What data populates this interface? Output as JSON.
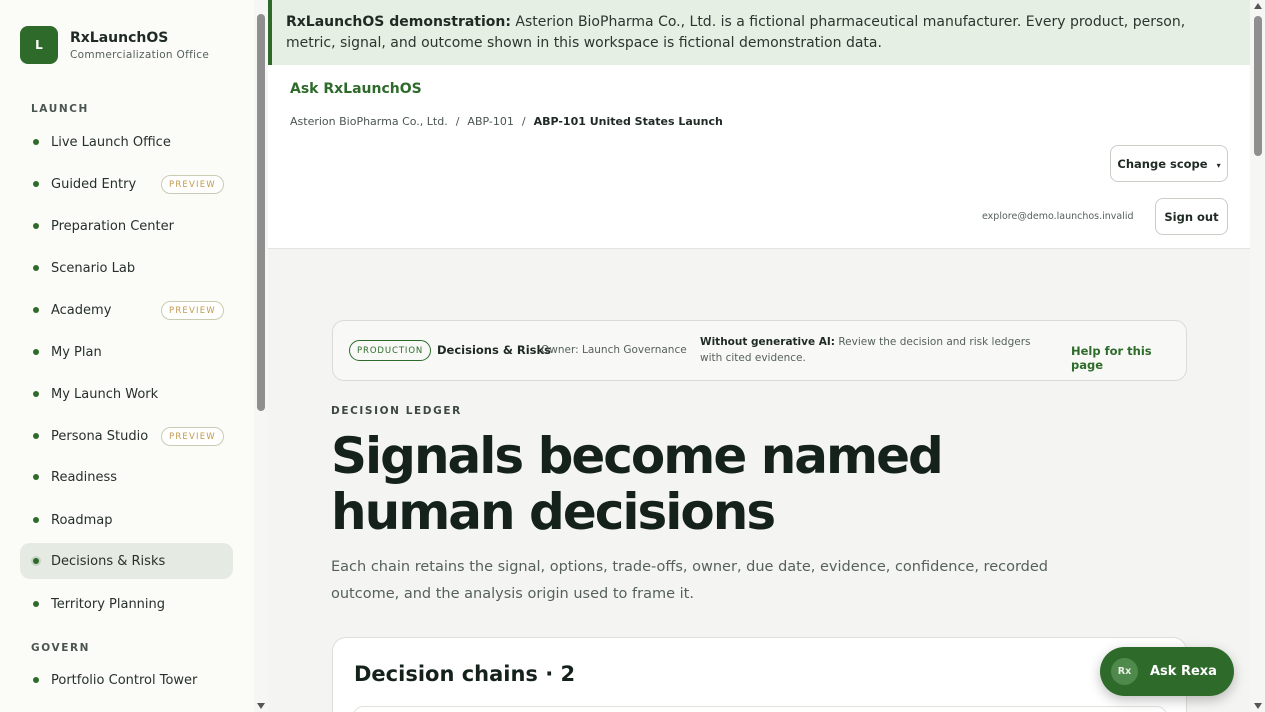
{
  "brand": {
    "logo_letter": "L",
    "name": "RxLaunchOS",
    "subtitle": "Commercialization Office"
  },
  "sidebar": {
    "sections": [
      {
        "label": "LAUNCH"
      },
      {
        "label": "GOVERN"
      }
    ],
    "items": [
      {
        "label": "Live Launch Office"
      },
      {
        "label": "Guided Entry",
        "badge": "PREVIEW"
      },
      {
        "label": "Preparation Center"
      },
      {
        "label": "Scenario Lab"
      },
      {
        "label": "Academy",
        "badge": "PREVIEW"
      },
      {
        "label": "My Plan"
      },
      {
        "label": "My Launch Work"
      },
      {
        "label": "Persona Studio",
        "badge": "PREVIEW"
      },
      {
        "label": "Readiness"
      },
      {
        "label": "Roadmap"
      },
      {
        "label": "Decisions & Risks",
        "active": true
      },
      {
        "label": "Territory Planning"
      },
      {
        "label": "Portfolio Control Tower"
      }
    ]
  },
  "banner": {
    "bold": "RxLaunchOS demonstration:",
    "text": " Asterion BioPharma Co., Ltd. is a fictional pharmaceutical manufacturer. Every product, person, metric, signal, and outcome shown in this workspace is fictional demonstration data."
  },
  "header": {
    "ask_link": "Ask RxLaunchOS",
    "breadcrumb": [
      "Asterion BioPharma Co., Ltd.",
      "ABP-101",
      "ABP-101 United States Launch"
    ],
    "breadcrumb_sep": "/",
    "change_scope": "Change scope",
    "chevron": "▾",
    "email": "explore@demo.launchos.invalid",
    "sign_out": "Sign out"
  },
  "page_strip": {
    "badge": "PRODUCTION",
    "title": "Decisions & Risks",
    "owner": "Owner: Launch Governance",
    "no_ai_label": "Without generative AI:",
    "no_ai_text": " Review the decision and risk ledgers with cited evidence.",
    "help": "Help for this page"
  },
  "hero": {
    "eyebrow": "DECISION LEDGER",
    "title": "Signals become named human decisions",
    "lede": "Each chain retains the signal, options, trade-offs, owner, due date, evidence, confidence, recorded outcome, and the analysis origin used to frame it."
  },
  "card": {
    "title": "Decision chains · 2"
  },
  "assistant": {
    "avatar": "Rx",
    "label": "Ask Rexa"
  },
  "colors": {
    "brand_green": "#2e6b2b",
    "banner_bg": "#e6efe3",
    "preview_badge": "#c29b4c",
    "main_bg": "#f4f5f2"
  }
}
